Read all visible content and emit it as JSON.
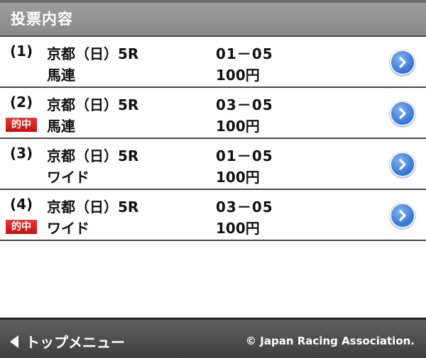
{
  "header": {
    "title": "投票内容"
  },
  "bets": [
    {
      "num": "(1)",
      "race": "京都（日）5R",
      "type": "馬連",
      "combo": "01－05",
      "amount": "100円",
      "hit": false
    },
    {
      "num": "(2)",
      "race": "京都（日）5R",
      "type": "馬連",
      "combo": "03－05",
      "amount": "100円",
      "hit": true
    },
    {
      "num": "(3)",
      "race": "京都（日）5R",
      "type": "ワイド",
      "combo": "01－05",
      "amount": "100円",
      "hit": false
    },
    {
      "num": "(4)",
      "race": "京都（日）5R",
      "type": "ワイド",
      "combo": "03－05",
      "amount": "100円",
      "hit": true
    }
  ],
  "hit_label": "的中",
  "footer": {
    "back_label": "トップメニュー",
    "copyright": "© Japan Racing Association."
  },
  "colors": {
    "header_bg": "#939393",
    "hit_badge": "#d61e1e",
    "arrow_button": "#2f6ed0"
  },
  "icons": {
    "arrow": "chevron-right-icon",
    "back": "back-triangle-icon"
  }
}
